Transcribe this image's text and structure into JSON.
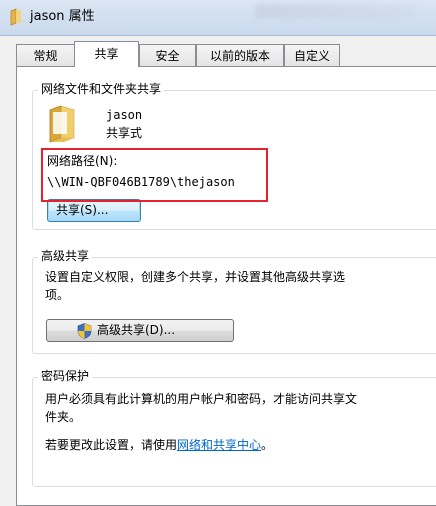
{
  "window": {
    "title": "jason 属性",
    "folder_icon": "folder-icon"
  },
  "tabs": [
    {
      "label": "常规"
    },
    {
      "label": "共享"
    },
    {
      "label": "安全"
    },
    {
      "label": "以前的版本"
    },
    {
      "label": "自定义"
    }
  ],
  "active_tab": "共享",
  "sharing": {
    "group_title": "网络文件和文件夹共享",
    "folder_name": "jason",
    "folder_status": "共享式",
    "network_path_label": "网络路径(N):",
    "network_path": "\\\\WIN-QBF046B1789\\thejason",
    "share_button": "共享(S)..."
  },
  "advanced": {
    "group_title": "高级共享",
    "description_line1": "设置自定义权限，创建多个共享，并设置其他高级共享选",
    "description_line2": "项。",
    "button": "高级共享(D)...",
    "button_icon": "uac-shield-icon"
  },
  "password": {
    "group_title": "密码保护",
    "description_line1": "用户必须具有此计算机的用户帐户和密码，才能访问共享文",
    "description_line2": "件夹。",
    "change_prefix": "若要更改此设置，请使用",
    "link_text": "网络和共享中心",
    "change_suffix": "。"
  },
  "highlight_color": "#e8212c",
  "link_color": "#0066cc"
}
